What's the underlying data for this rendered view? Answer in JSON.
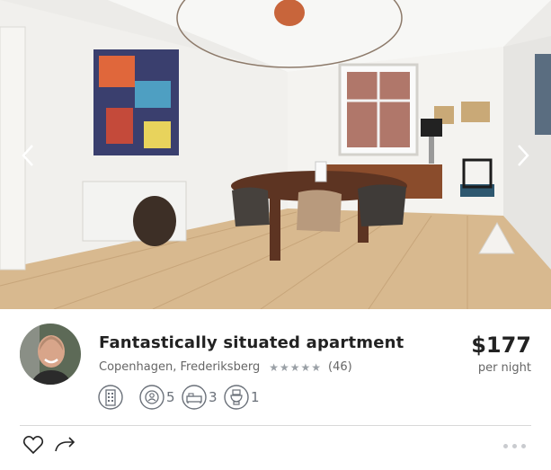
{
  "listing": {
    "title": "Fantastically situated apartment",
    "location": "Copenhagen, Frederiksberg",
    "rating_stars": 5,
    "review_count": "(46)",
    "price": "$177",
    "price_unit": "per night"
  },
  "amenities": [
    {
      "icon": "building-icon",
      "value": ""
    },
    {
      "icon": "guests-icon",
      "value": "5"
    },
    {
      "icon": "bed-icon",
      "value": "3"
    },
    {
      "icon": "toilet-icon",
      "value": "1"
    }
  ],
  "actions": {
    "favorite_icon": "heart-icon",
    "share_icon": "share-icon",
    "more_icon": "more-dots-icon"
  },
  "gallery": {
    "prev_icon": "chevron-left-icon",
    "next_icon": "chevron-right-icon"
  },
  "colors": {
    "text_primary": "#222222",
    "text_secondary": "#666666",
    "icon_gray": "#6a7079",
    "divider": "#d8d8d8"
  }
}
